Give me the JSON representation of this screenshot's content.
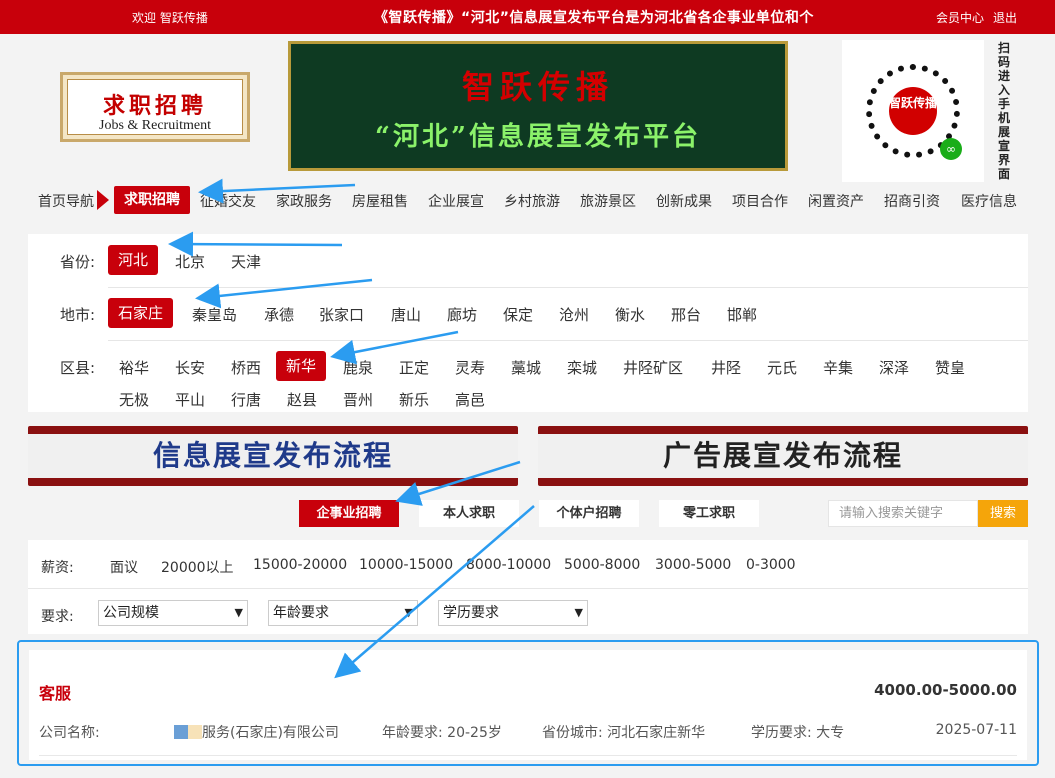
{
  "topbar": {
    "welcome": "欢迎 智跃传播",
    "marquee": "《智跃传播》“河北”信息展宣发布平台是为河北省各企事业单位和个",
    "member": "会员中心",
    "logout": "退出"
  },
  "header": {
    "brand_cn": "求职招聘",
    "brand_en": "Jobs & Recruitment",
    "banner_line1": "智跃传播",
    "banner_line2": "“河北”信息展宣发布平台",
    "qr_center": "智跃传播",
    "qr_text": "扫码进入手机展宣界面"
  },
  "nav": {
    "home": "首页导航",
    "items": [
      "求职招聘",
      "征婚交友",
      "家政服务",
      "房屋租售",
      "企业展宣",
      "乡村旅游",
      "旅游景区",
      "创新成果",
      "项目合作",
      "闲置资产",
      "招商引资",
      "医疗信息"
    ]
  },
  "filters": {
    "province_label": "省份:",
    "provinces": [
      "河北",
      "北京",
      "天津"
    ],
    "city_label": "地市:",
    "cities": [
      "石家庄",
      "秦皇岛",
      "承德",
      "张家口",
      "唐山",
      "廊坊",
      "保定",
      "沧州",
      "衡水",
      "邢台",
      "邯郸"
    ],
    "district_label": "区县:",
    "districts_row1": [
      "裕华",
      "长安",
      "桥西",
      "新华",
      "鹿泉",
      "正定",
      "灵寿",
      "藁城",
      "栾城",
      "井陉矿区",
      "井陉",
      "元氏",
      "辛集",
      "深泽",
      "赞皇"
    ],
    "districts_row2": [
      "无极",
      "平山",
      "行唐",
      "赵县",
      "晋州",
      "新乐",
      "高邑"
    ]
  },
  "flows": {
    "info": "信息展宣发布流程",
    "ad": "广告展宣发布流程"
  },
  "tabs": [
    "企事业招聘",
    "本人求职",
    "个体户招聘",
    "零工求职"
  ],
  "search": {
    "placeholder": "请输入搜索关键字",
    "button": "搜索"
  },
  "salary": {
    "label": "薪资:",
    "options": [
      "面议",
      "20000以上",
      "15000-20000",
      "10000-15000",
      "8000-10000",
      "5000-8000",
      "3000-5000",
      "0-3000"
    ]
  },
  "requirements": {
    "label": "要求:",
    "selects": [
      "公司规模",
      "年龄要求",
      "学历要求"
    ]
  },
  "job": {
    "title": "客服",
    "salary": "4000.00-5000.00",
    "company_label": "公司名称:",
    "company": "服务(石家庄)有限公司",
    "age": "年龄要求: 20-25岁",
    "location": "省份城市: 河北石家庄新华",
    "education": "学历要求: 大专",
    "date": "2025-07-11"
  },
  "colors": {
    "brand_red": "#c8000b",
    "accent_orange": "#f5a50a",
    "highlight_blue": "#2b9cf0"
  }
}
